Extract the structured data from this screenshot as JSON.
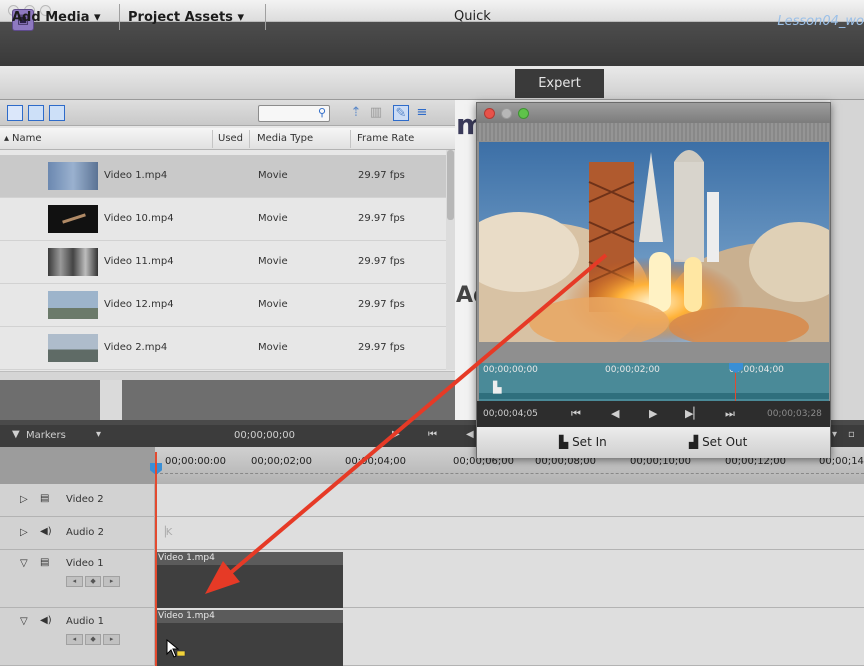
{
  "app": {
    "project_title": "Lesson04_wo",
    "app_icon": "film-icon"
  },
  "menu": {
    "add_media": "Add Media",
    "project_assets": "Project Assets",
    "dropdown_glyph": "▾",
    "quick": "Quick",
    "expert": "Expert"
  },
  "assets": {
    "columns": {
      "name": "Name",
      "used": "Used",
      "media_type": "Media Type",
      "frame_rate": "Frame Rate"
    },
    "sort_glyph": "▴",
    "rows": [
      {
        "name": "Video 1.mp4",
        "type": "Movie",
        "rate": "29.97 fps"
      },
      {
        "name": "Video 10.mp4",
        "type": "Movie",
        "rate": "29.97 fps"
      },
      {
        "name": "Video 11.mp4",
        "type": "Movie",
        "rate": "29.97 fps"
      },
      {
        "name": "Video 12.mp4",
        "type": "Movie",
        "rate": "29.97 fps"
      },
      {
        "name": "Video 2.mp4",
        "type": "Movie",
        "rate": "29.97 fps"
      }
    ]
  },
  "background": {
    "title_fragment": "m",
    "subtitle_fragment": "Ad"
  },
  "monitor": {
    "scrub_times": [
      "00;00;00;00",
      "00;00;02;00",
      "00;00;04;00"
    ],
    "current_time": "00;00;04;05",
    "duration": "00;00;03;28",
    "set_in": "Set In",
    "set_out": "Set Out"
  },
  "timeline": {
    "markers_label": "Markers",
    "time_display": "00;00;00;00",
    "ruler": [
      "00;00:00:00",
      "00;00;02;00",
      "00;00;04;00",
      "00;00;06;00",
      "00;00;08;00",
      "00;00;10;00",
      "00;00;12;00",
      "00;00;14"
    ],
    "tracks": [
      {
        "name": "Video 2"
      },
      {
        "name": "Audio 2"
      },
      {
        "name": "Video 1",
        "clip": "Video 1.mp4"
      },
      {
        "name": "Audio 1",
        "clip": "Video 1.mp4"
      }
    ]
  },
  "colors": {
    "playhead": "#e34a2f",
    "arrow": "#e63a26",
    "accent_blue": "#2e6bc9"
  }
}
